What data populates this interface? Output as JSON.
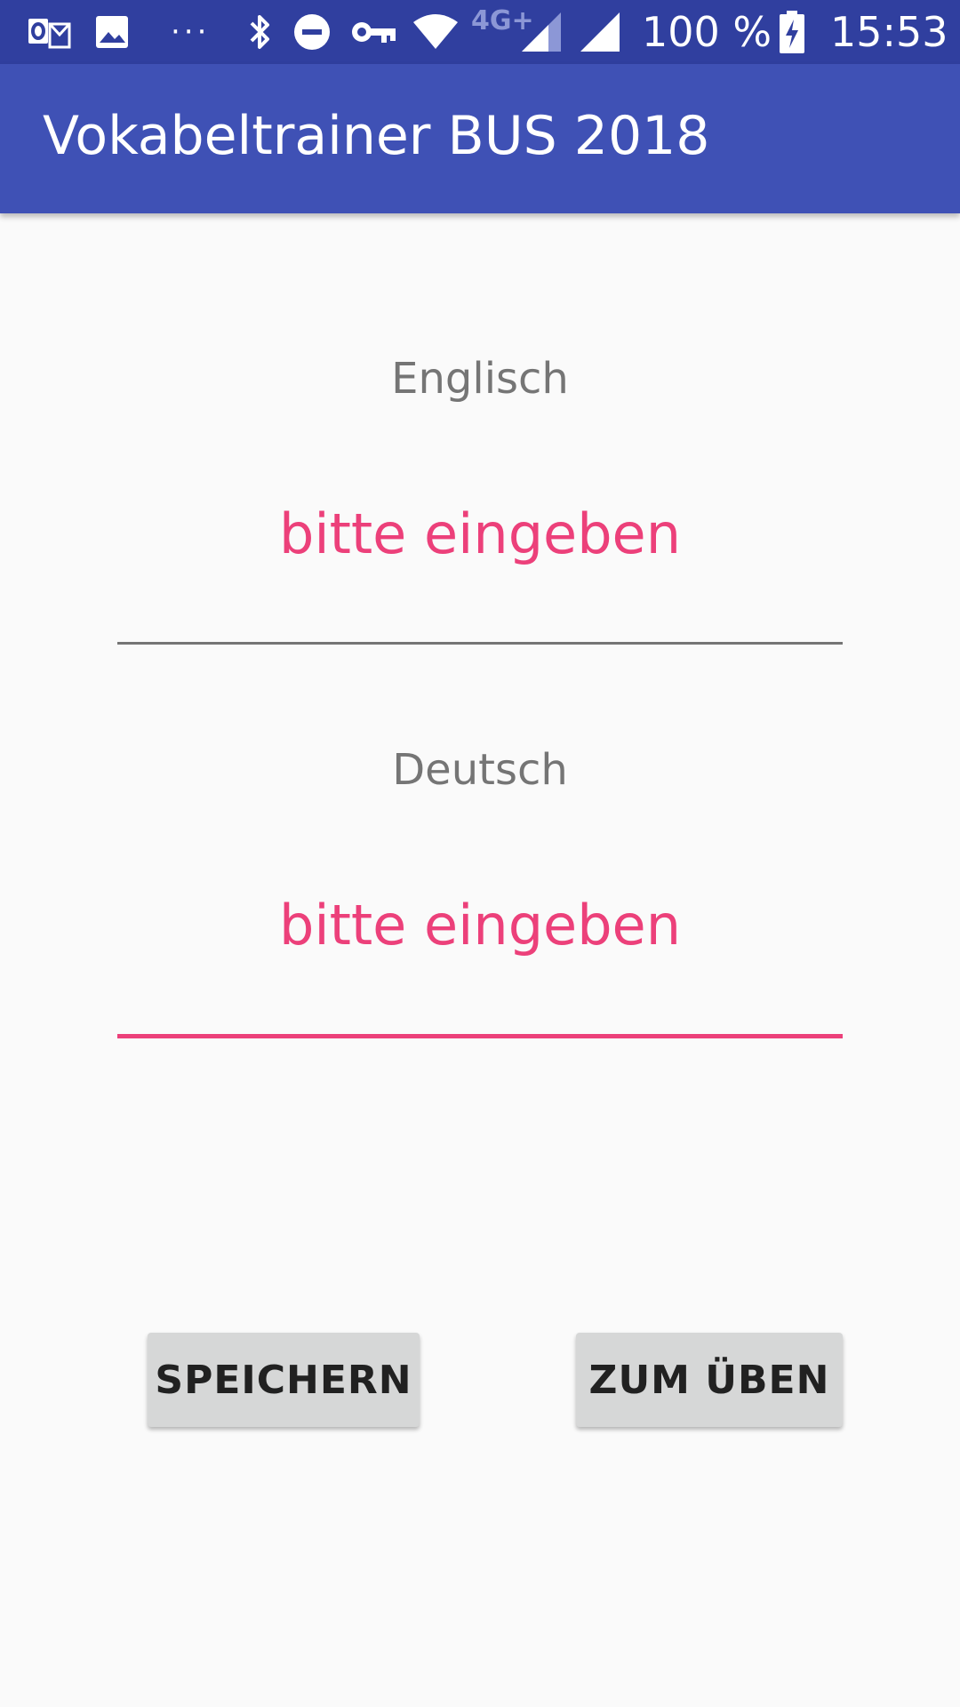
{
  "status_bar": {
    "battery_text": "100 %",
    "time": "15:53",
    "network_type": "4G+",
    "overflow": "···",
    "icons": [
      "outlook-icon",
      "image-icon",
      "more-icon",
      "bluetooth-icon",
      "do-not-disturb-icon",
      "vpn-key-icon",
      "wifi-icon",
      "signal-icon",
      "signal-icon",
      "battery-charging-icon"
    ]
  },
  "app_bar": {
    "title": "Vokabeltrainer BUS 2018"
  },
  "form": {
    "english": {
      "label": "Englisch",
      "placeholder": "bitte eingeben"
    },
    "german": {
      "label": "Deutsch",
      "placeholder": "bitte eingeben"
    }
  },
  "buttons": {
    "save_label": "SPEICHERN",
    "practice_label": "ZUM ÜBEN"
  },
  "colors": {
    "status_bar": "#303f9f",
    "app_bar": "#3f51b5",
    "accent": "#ec407a",
    "background": "#fafafa",
    "button": "#d6d7d7"
  }
}
